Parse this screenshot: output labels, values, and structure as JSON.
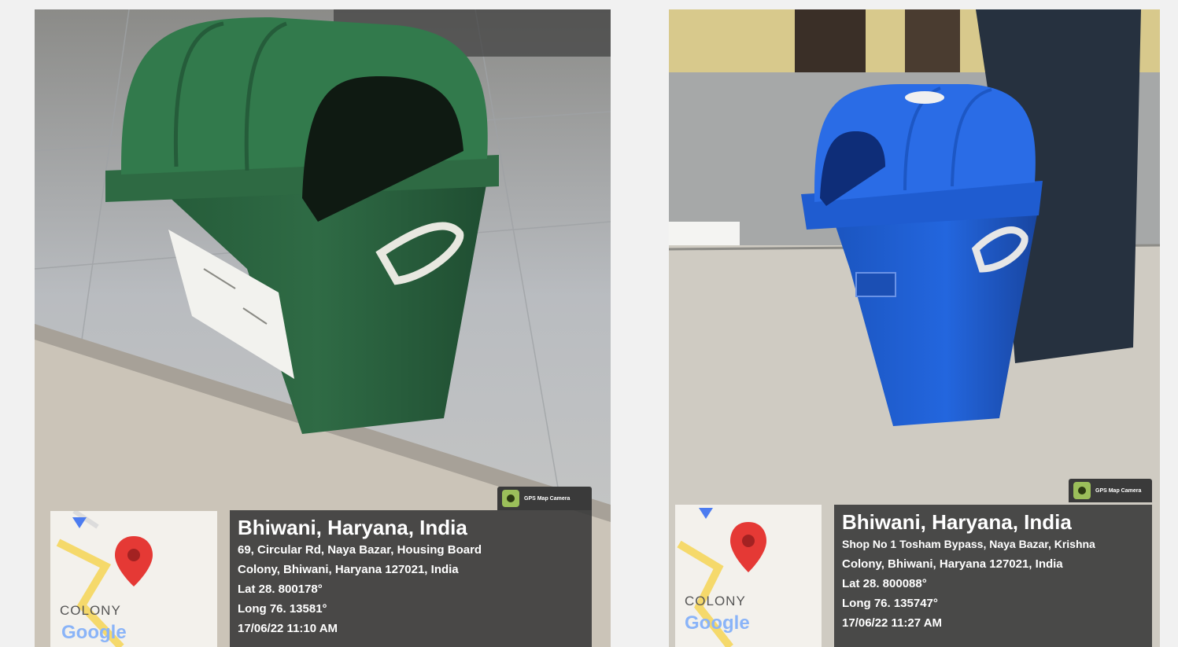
{
  "photos": [
    {
      "bin_color": "#2f6b45",
      "badge": "GPS Map Camera",
      "map": {
        "area_label": "COLONY",
        "logo": "Google"
      },
      "location": {
        "title": "Bhiwani, Haryana, India",
        "address_line1": "69, Circular Rd, Naya Bazar, Housing Board",
        "address_line2": "Colony, Bhiwani, Haryana 127021, India",
        "lat": "Lat 28. 800178°",
        "long": "Long 76. 13581°",
        "timestamp": "17/06/22 11:10 AM"
      }
    },
    {
      "bin_color": "#1f5fd0",
      "badge": "GPS Map Camera",
      "map": {
        "area_label": "COLONY",
        "logo": "Google"
      },
      "location": {
        "title": "Bhiwani, Haryana, India",
        "address_line1": "Shop No 1 Tosham Bypass, Naya Bazar, Krishna",
        "address_line2": "Colony, Bhiwani, Haryana 127021, India",
        "lat": "Lat 28. 800088°",
        "long": "Long 76. 135747°",
        "timestamp": "17/06/22 11:27 AM"
      }
    }
  ]
}
